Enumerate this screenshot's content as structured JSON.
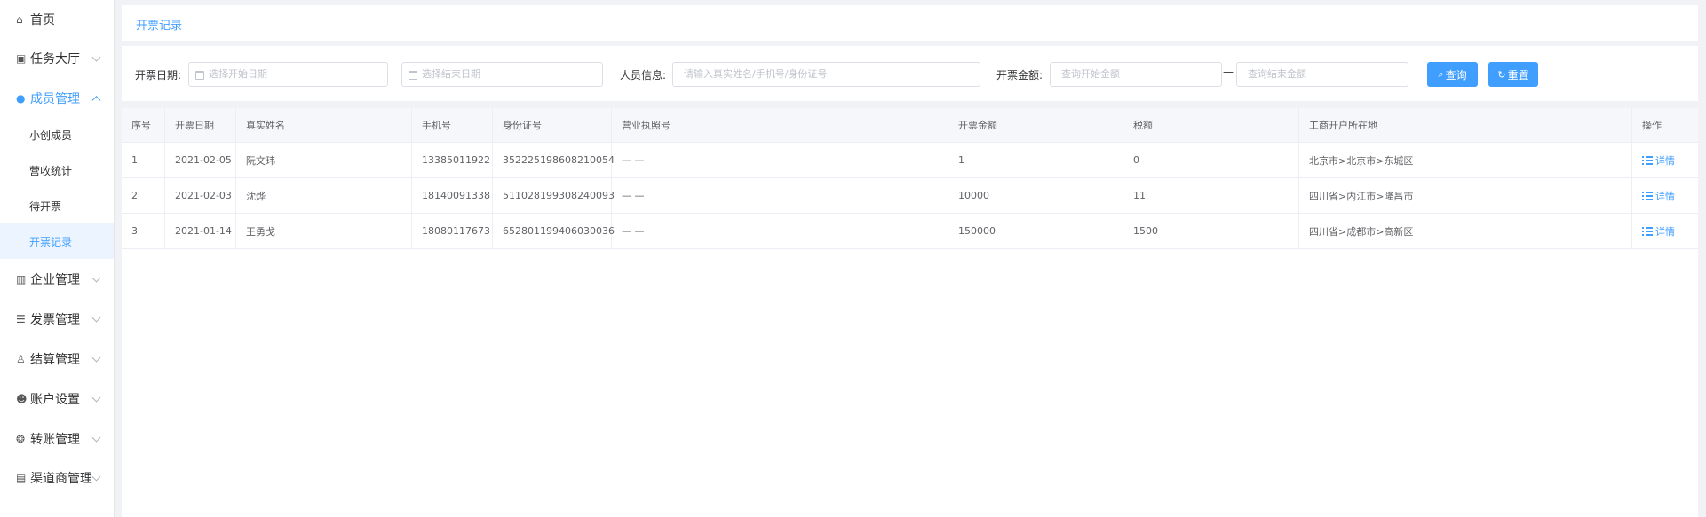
{
  "sidebar": {
    "items": [
      {
        "label": "首页",
        "icon": "home-icon",
        "glyph": "⌂",
        "expandable": false
      },
      {
        "label": "任务大厅",
        "icon": "task-icon",
        "glyph": "▣",
        "expandable": true
      },
      {
        "label": "成员管理",
        "icon": "members-icon",
        "glyph": "●",
        "expandable": true,
        "expanded": true,
        "children": [
          {
            "label": "小创成员"
          },
          {
            "label": "营收统计"
          },
          {
            "label": "待开票"
          },
          {
            "label": "开票记录",
            "active": true
          }
        ]
      },
      {
        "label": "企业管理",
        "icon": "building-icon",
        "glyph": "▥",
        "expandable": true
      },
      {
        "label": "发票管理",
        "icon": "invoice-icon",
        "glyph": "☰",
        "expandable": true
      },
      {
        "label": "结算管理",
        "icon": "settlement-icon",
        "glyph": "♙",
        "expandable": true
      },
      {
        "label": "账户设置",
        "icon": "account-icon",
        "glyph": "☻",
        "expandable": true
      },
      {
        "label": "转账管理",
        "icon": "transfer-icon",
        "glyph": "❂",
        "expandable": true
      },
      {
        "label": "渠道商管理",
        "icon": "channel-icon",
        "glyph": "▤",
        "expandable": true
      }
    ]
  },
  "breadcrumb": {
    "current": "开票记录"
  },
  "filters": {
    "date_label": "开票日期:",
    "start_date_placeholder": "选择开始日期",
    "date_sep": "-",
    "end_date_placeholder": "选择结束日期",
    "person_label": "人员信息:",
    "person_placeholder": "请输入真实姓名/手机号/身份证号",
    "amount_label": "开票金额:",
    "amount_start_placeholder": "查询开始金额",
    "amount_sep": "—",
    "amount_end_placeholder": "查询结束金额",
    "search_label": "查询",
    "reset_label": "重置"
  },
  "table": {
    "headers": [
      "序号",
      "开票日期",
      "真实姓名",
      "手机号",
      "身份证号",
      "营业执照号",
      "开票金额",
      "税额",
      "工商开户所在地",
      "操作"
    ],
    "rows": [
      {
        "no": "1",
        "date": "2021-02-05",
        "name": "阮文玮",
        "phone": "13385011922",
        "id_no": "352225198608210054",
        "license": "— —",
        "amount": "1",
        "tax": "0",
        "location": "北京市>北京市>东城区",
        "action": "详情"
      },
      {
        "no": "2",
        "date": "2021-02-03",
        "name": "沈烨",
        "phone": "18140091338",
        "id_no": "511028199308240093",
        "license": "— —",
        "amount": "10000",
        "tax": "11",
        "location": "四川省>内江市>隆昌市",
        "action": "详情"
      },
      {
        "no": "3",
        "date": "2021-01-14",
        "name": "王勇戈",
        "phone": "18080117673",
        "id_no": "652801199406030036",
        "license": "— —",
        "amount": "150000",
        "tax": "1500",
        "location": "四川省>成都市>高新区",
        "action": "详情"
      }
    ]
  },
  "colors": {
    "accent": "#409eff",
    "active_bg": "#ecf5ff",
    "page_bg": "#f0f2f5"
  }
}
